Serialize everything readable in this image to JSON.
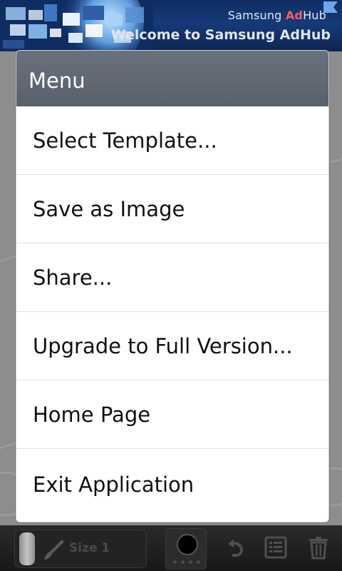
{
  "ad_banner": {
    "brand_prefix": "Samsung ",
    "brand_accent": "Ad",
    "brand_suffix": "Hub",
    "welcome_text": "Welcome to Samsung AdHub",
    "accent_color": "#ff5b6b"
  },
  "menu": {
    "title": "Menu",
    "items": [
      {
        "label": "Select Template..."
      },
      {
        "label": "Save as Image"
      },
      {
        "label": "Share..."
      },
      {
        "label": "Upgrade to Full Version..."
      },
      {
        "label": "Home Page"
      },
      {
        "label": "Exit Application"
      }
    ]
  },
  "toolbar": {
    "size_label": "Size 1",
    "brush_icon": "brush-icon",
    "current_color": "#000000",
    "icons": [
      "undo-icon",
      "list-icon",
      "trash-icon"
    ]
  }
}
